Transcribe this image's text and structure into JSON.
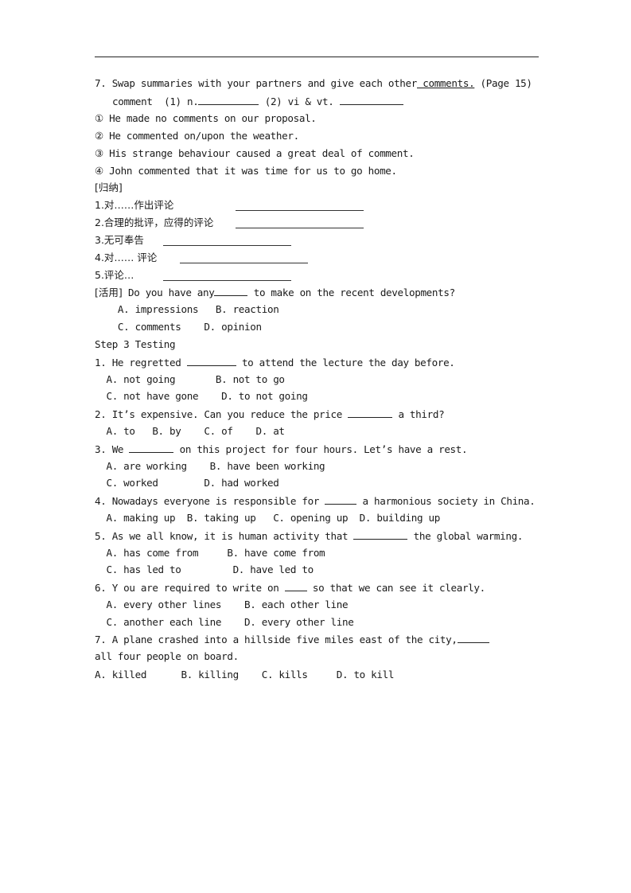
{
  "header_rule": true,
  "section7": {
    "prompt_prefix": "7. Swap summaries with your partners and give each other",
    "prompt_underlined": " comments.",
    "prompt_suffix": " (Page 15)",
    "comment_label": "comment  (1) n.",
    "comment_mid": " (2) vi & vt.",
    "examples": [
      "① He made no comments on our proposal.",
      "② He commented on/upon the weather.",
      "③ His strange behaviour caused a great deal of comment.",
      "④ John commented that it was time for us to go home."
    ],
    "summary_header": "[归纳]",
    "summary_items": [
      "1.对……作出评论",
      "2.合理的批评，应得的评论",
      "3.无可奉告",
      "4.对…… 评论",
      "5.评论…"
    ],
    "apply_label": "[活用]",
    "apply_question_prefix": " Do you have any",
    "apply_question_suffix": " to make on the recent developments?",
    "apply_options_row1": "    A. impressions   B. reaction",
    "apply_options_row2": "    C. comments    D. opinion"
  },
  "step3": {
    "title": "Step 3 Testing",
    "questions": [
      {
        "prefix": "1. He regretted ",
        "suffix": " to attend the lecture the day before.",
        "options": [
          "  A. not going       B. not to go",
          "  C. not have gone    D. to not going"
        ]
      },
      {
        "prefix": "2. It’s expensive. Can you reduce the price ",
        "suffix": " a third?",
        "options": [
          "  A. to   B. by    C. of    D. at"
        ]
      },
      {
        "prefix": "3. We ",
        "suffix": " on this project for four hours. Let’s have a rest.",
        "options": [
          "  A. are working    B. have been working",
          "  C. worked        D. had worked"
        ]
      },
      {
        "prefix": "4. Nowadays everyone is responsible for ",
        "suffix": " a harmonious society in China.",
        "options": [
          "  A. making up  B. taking up   C. opening up  D. building up"
        ]
      },
      {
        "prefix": "5. As we all know, it is human activity that ",
        "suffix": " the global warming.",
        "options": [
          "  A. has come from     B. have come from",
          "  C. has led to         D. have led to"
        ]
      },
      {
        "prefix": "6. Y ou are required to write on ",
        "suffix": " so that we can see it clearly.",
        "options": [
          "  A. every other lines    B. each other line",
          "  C. another each line    D. every other line"
        ]
      },
      {
        "prefix": "7. A plane crashed into a hillside five miles east of the city,",
        "suffix": "",
        "continuation": "all four people on board.",
        "options": [
          "A. killed      B. killing    C. kills     D. to kill"
        ]
      }
    ]
  }
}
